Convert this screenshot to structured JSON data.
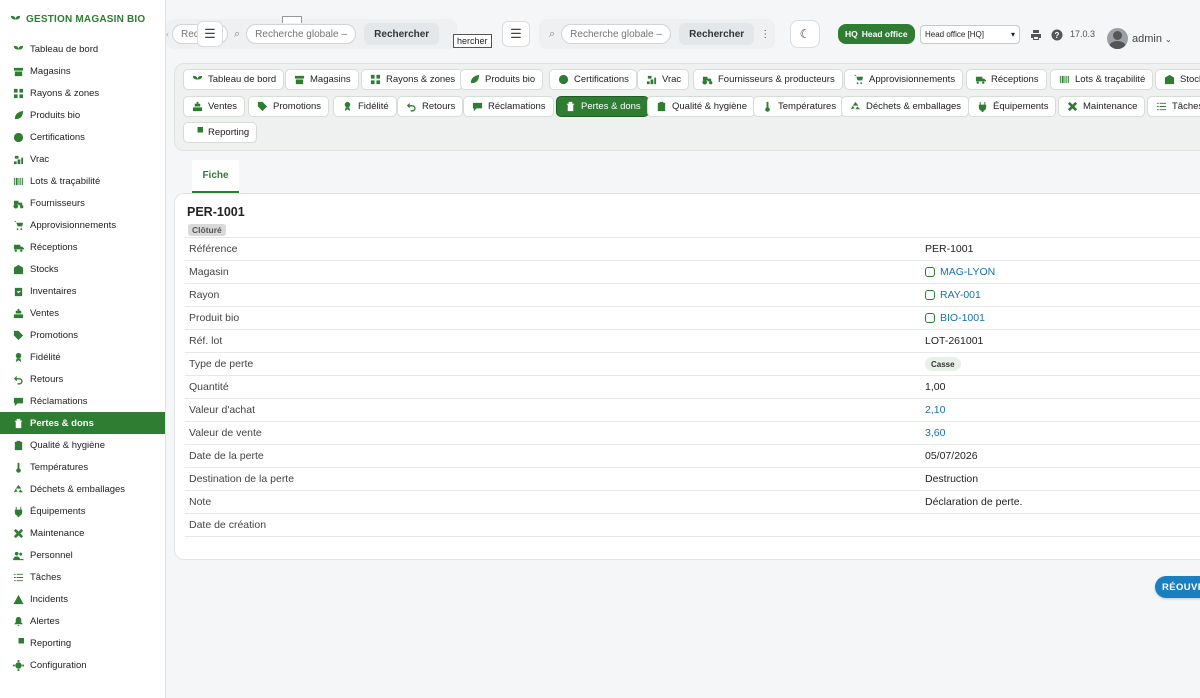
{
  "brand": "GESTION MAGASIN BIO",
  "sidebar": [
    {
      "label": "Tableau de bord",
      "icon": "sprout-icon"
    },
    {
      "label": "Magasins",
      "icon": "store-icon"
    },
    {
      "label": "Rayons & zones",
      "icon": "grid-icon"
    },
    {
      "label": "Produits bio",
      "icon": "leaf-icon"
    },
    {
      "label": "Certifications",
      "icon": "badge-icon"
    },
    {
      "label": "Vrac",
      "icon": "bins-icon"
    },
    {
      "label": "Lots & traçabilité",
      "icon": "barcode-icon"
    },
    {
      "label": "Fournisseurs",
      "icon": "tractor-icon"
    },
    {
      "label": "Approvisionnements",
      "icon": "cart-icon"
    },
    {
      "label": "Réceptions",
      "icon": "truck-icon"
    },
    {
      "label": "Stocks",
      "icon": "warehouse-icon"
    },
    {
      "label": "Inventaires",
      "icon": "clipboard-check-icon"
    },
    {
      "label": "Ventes",
      "icon": "cash-register-icon"
    },
    {
      "label": "Promotions",
      "icon": "tags-icon"
    },
    {
      "label": "Fidélité",
      "icon": "award-icon"
    },
    {
      "label": "Retours",
      "icon": "undo-icon"
    },
    {
      "label": "Réclamations",
      "icon": "comment-icon"
    },
    {
      "label": "Pertes & dons",
      "icon": "trash-icon"
    },
    {
      "label": "Qualité & hygiène",
      "icon": "clipboard-icon"
    },
    {
      "label": "Températures",
      "icon": "thermometer-icon"
    },
    {
      "label": "Déchets & emballages",
      "icon": "recycle-icon"
    },
    {
      "label": "Équipements",
      "icon": "plug-icon"
    },
    {
      "label": "Maintenance",
      "icon": "tools-icon"
    },
    {
      "label": "Personnel",
      "icon": "users-icon"
    },
    {
      "label": "Tâches",
      "icon": "list-icon"
    },
    {
      "label": "Incidents",
      "icon": "warning-icon"
    },
    {
      "label": "Alertes",
      "icon": "bell-icon"
    },
    {
      "label": "Reporting",
      "icon": "pie-icon"
    },
    {
      "label": "Configuration",
      "icon": "gear-icon"
    }
  ],
  "sidebar_active": "Pertes & dons",
  "header": {
    "search_placeholder": "Recherche globale — cl",
    "search_placeholder_short": "Rech",
    "search_placeholder_short2": "g",
    "search_button": "Rechercher",
    "tooltip_fragment": "hercher",
    "hq_badge_code": "HQ",
    "hq_badge_label": "Head office",
    "office_select": "Head office [HQ]",
    "version": "17.0.3",
    "user": "admin"
  },
  "module_tabs": [
    {
      "label": "Tableau de bord",
      "icon": "sprout-icon"
    },
    {
      "label": "Magasins",
      "icon": "store-icon"
    },
    {
      "label": "Rayons & zones",
      "icon": "grid-icon"
    },
    {
      "label": "Produits bio",
      "icon": "leaf-icon"
    },
    {
      "label": "Certifications",
      "icon": "badge-icon"
    },
    {
      "label": "Vrac",
      "icon": "bins-icon"
    },
    {
      "label": "Fournisseurs & producteurs",
      "icon": "tractor-icon"
    },
    {
      "label": "Approvisionnements",
      "icon": "cart-icon"
    },
    {
      "label": "Réceptions",
      "icon": "truck-icon"
    },
    {
      "label": "Lots & traçabilité",
      "icon": "barcode-icon"
    },
    {
      "label": "Stock",
      "icon": "warehouse-icon"
    },
    {
      "label": "Ventes",
      "icon": "cash-register-icon"
    },
    {
      "label": "Promotions",
      "icon": "tags-icon"
    },
    {
      "label": "Fidélité",
      "icon": "award-icon"
    },
    {
      "label": "Retours",
      "icon": "undo-icon"
    },
    {
      "label": "Réclamations",
      "icon": "comment-icon"
    },
    {
      "label": "Pertes & dons",
      "icon": "trash-icon"
    },
    {
      "label": "Qualité & hygiène",
      "icon": "clipboard-icon"
    },
    {
      "label": "Températures",
      "icon": "thermometer-icon"
    },
    {
      "label": "Déchets & emballages",
      "icon": "recycle-icon"
    },
    {
      "label": "Équipements",
      "icon": "plug-icon"
    },
    {
      "label": "Maintenance",
      "icon": "tools-icon"
    },
    {
      "label": "Tâches",
      "icon": "list-icon"
    },
    {
      "label": "Reporting",
      "icon": "pie-icon"
    }
  ],
  "module_active": "Pertes & dons",
  "record": {
    "tab": "Fiche",
    "title": "PER-1001",
    "status": "Clôturé",
    "fields": [
      {
        "label": "Référence",
        "value": "PER-1001",
        "kind": "text"
      },
      {
        "label": "Magasin",
        "value": "MAG-LYON",
        "kind": "link"
      },
      {
        "label": "Rayon",
        "value": "RAY-001",
        "kind": "link"
      },
      {
        "label": "Produit bio",
        "value": "BIO-1001",
        "kind": "link"
      },
      {
        "label": "Réf. lot",
        "value": "LOT-261001",
        "kind": "text"
      },
      {
        "label": "Type de perte",
        "value": "Casse",
        "kind": "pill"
      },
      {
        "label": "Quantité",
        "value": "1,00",
        "kind": "text"
      },
      {
        "label": "Valeur d'achat",
        "value": "2,10",
        "kind": "num"
      },
      {
        "label": "Valeur de vente",
        "value": "3,60",
        "kind": "num"
      },
      {
        "label": "Date de la perte",
        "value": "05/07/2026",
        "kind": "text"
      },
      {
        "label": "Destination de la perte",
        "value": "Destruction",
        "kind": "text"
      },
      {
        "label": "Note",
        "value": "Déclaration de perte.",
        "kind": "text"
      },
      {
        "label": "Date de création",
        "value": "",
        "kind": "text"
      }
    ],
    "reopen_button": "RÉOUVR"
  },
  "colors": {
    "brand_green": "#2e7d32",
    "link_blue": "#1a6fb0",
    "reopen_blue": "#1a7fc0"
  }
}
